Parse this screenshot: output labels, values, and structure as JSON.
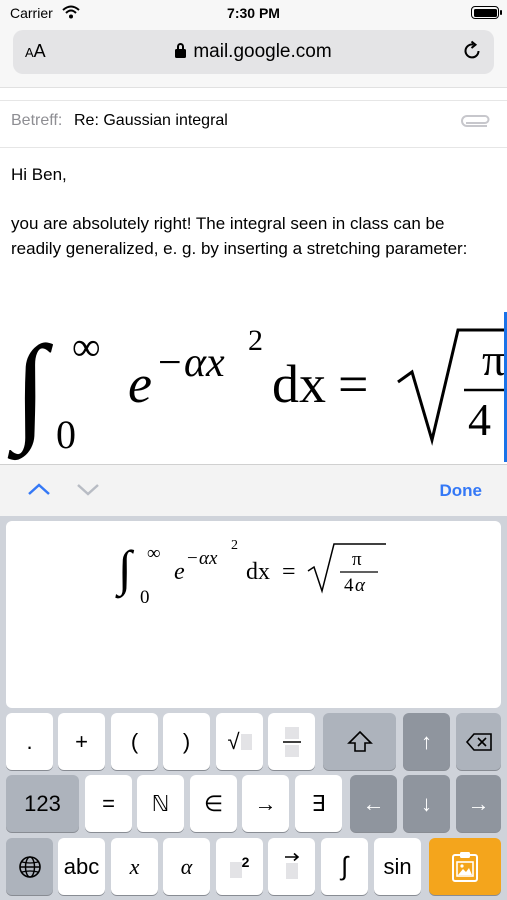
{
  "status": {
    "carrier": "Carrier",
    "time": "7:30 PM"
  },
  "browser": {
    "aa_label": "AA",
    "url": "mail.google.com"
  },
  "email": {
    "subject_label": "Betreff:",
    "subject": "Re: Gaussian integral",
    "greeting": "Hi Ben,",
    "paragraph": "you are absolutely right! The integral seen in class can be readily generalized, e. g. by inserting a stretching parameter:"
  },
  "accessory": {
    "done_label": "Done"
  },
  "keyboard": {
    "row1": [
      ".",
      "+",
      "(",
      ")",
      "√",
      "frac",
      "shift",
      "↑",
      "backspace"
    ],
    "row2": [
      "123",
      "=",
      "ℕ",
      "∈",
      "→",
      "∃",
      "←",
      "↓",
      "→"
    ],
    "row3": [
      "globe",
      "abc",
      "x",
      "α",
      "square",
      "overarrow",
      "∫",
      "sin",
      "paste"
    ]
  },
  "colors": {
    "accent": "#3478f6",
    "cursor": "#1a73e8",
    "paste_key": "#f4a51c"
  }
}
